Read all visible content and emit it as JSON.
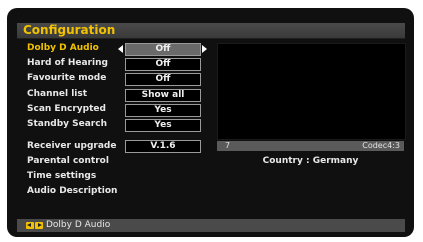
{
  "menu": {
    "title": "Configuration",
    "items": [
      {
        "label": "Dolby D Audio",
        "value": "Off",
        "active": true
      },
      {
        "label": "Hard of Hearing",
        "value": "Off"
      },
      {
        "label": "Favourite mode",
        "value": "Off"
      },
      {
        "label": "Channel list",
        "value": "Show all"
      },
      {
        "label": "Scan Encrypted",
        "value": "Yes"
      },
      {
        "label": "Standby Search",
        "value": "Yes"
      },
      {
        "label": "Receiver upgrade",
        "value": "V.1.6"
      },
      {
        "label": "Parental control"
      },
      {
        "label": "Time settings"
      },
      {
        "label": "Audio Description"
      }
    ]
  },
  "preview": {
    "channel": "7",
    "codec": "Codec4:3",
    "country": "Country : Germany"
  },
  "footer": {
    "hint": "Dolby D Audio"
  },
  "colors": {
    "accent": "#f2c200",
    "background": "#101010",
    "bar": "#4a4a4a"
  }
}
